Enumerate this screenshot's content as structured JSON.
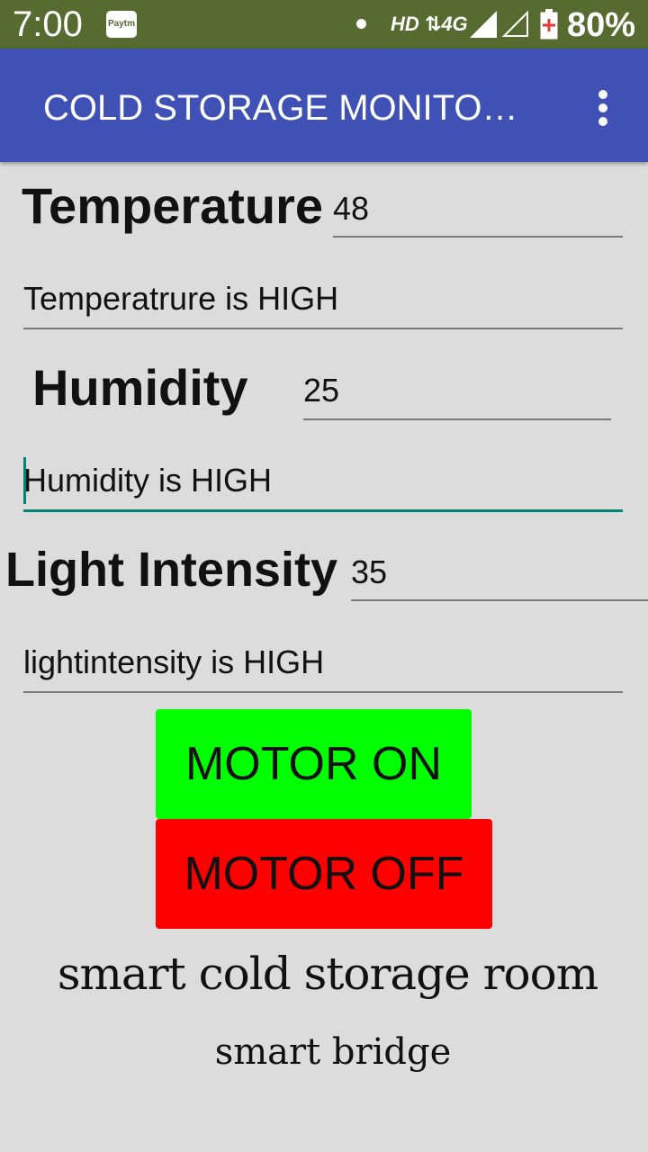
{
  "status_bar": {
    "time": "7:00",
    "notification_icon": "paytm-icon",
    "paytm_label": "Paytm",
    "network": "HD ⇅4G",
    "battery": "80%"
  },
  "app_bar": {
    "title": "COLD STORAGE MONITO…",
    "overflow_icon": "more-vert-icon"
  },
  "temperature": {
    "label": "Temperature",
    "value": "48",
    "status": "Temperatrure is HIGH"
  },
  "humidity": {
    "label": "Humidity",
    "value": "25",
    "status": "Humidity is HIGH"
  },
  "light": {
    "label": "Light Intensity",
    "value": "35",
    "status": "lightintensity is HIGH"
  },
  "buttons": {
    "motor_on": "MOTOR ON",
    "motor_off": "MOTOR OFF"
  },
  "footer": {
    "title": "smart cold storage room",
    "subtitle": "smart bridge"
  },
  "colors": {
    "status_bar": "#556b2f",
    "app_bar": "#3f51b5",
    "accent": "#008577",
    "motor_on": "#00ff00",
    "motor_off": "#ff0000"
  }
}
